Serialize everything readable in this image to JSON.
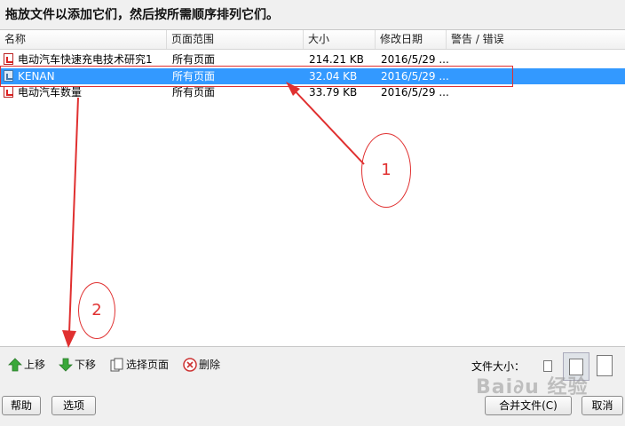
{
  "instruction": "拖放文件以添加它们，然后按所需顺序排列它们。",
  "columns": [
    "名称",
    "页面范围",
    "大小",
    "修改日期",
    "警告 / 错误"
  ],
  "files": [
    {
      "name": "电动汽车快速充电技术研究1",
      "range": "所有页面",
      "size": "214.21 KB",
      "date": "2016/5/29 ...",
      "icon": "pdf-icon",
      "selected": false
    },
    {
      "name": "KENAN",
      "range": "所有页面",
      "size": "32.04 KB",
      "date": "2016/5/29 ...",
      "icon": "image-file-icon",
      "selected": true
    },
    {
      "name": "电动汽车数量",
      "range": "所有页面",
      "size": "33.79 KB",
      "date": "2016/5/29 ...",
      "icon": "pdf-icon",
      "selected": false
    }
  ],
  "annotations": {
    "label_1": "1",
    "label_2": "2",
    "color": "#e03030"
  },
  "toolbar": {
    "move_up": "上移",
    "move_down": "下移",
    "select_pages": "选择页面",
    "delete": "删除",
    "file_size_label": "文件大小："
  },
  "buttons": {
    "help": "帮助",
    "options": "选项",
    "merge": "合并文件(C)",
    "cancel": "取消"
  },
  "colors": {
    "selection": "#3399ff",
    "annotation": "#e03030"
  }
}
